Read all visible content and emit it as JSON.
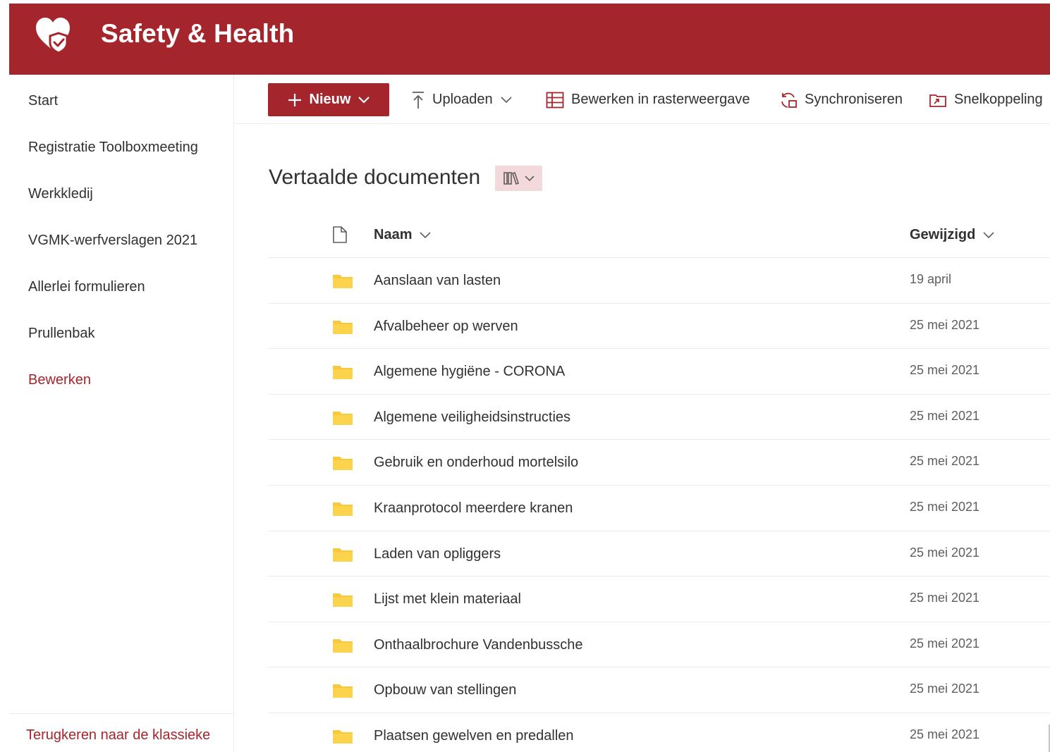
{
  "header": {
    "site_title": "Safety & Health",
    "logo_icon": "heart-shield-icon"
  },
  "colors": {
    "brand": "#a4262c",
    "view_switch_bg": "#f4d9da",
    "folder": "#f8c93c",
    "text": "#323130",
    "secondary_text": "#605e5c"
  },
  "sidebar": {
    "items": [
      {
        "label": "Start"
      },
      {
        "label": "Registratie Toolboxmeeting"
      },
      {
        "label": "Werkkledij"
      },
      {
        "label": "VGMK-werfverslagen 2021"
      },
      {
        "label": "Allerlei formulieren"
      },
      {
        "label": "Prullenbak"
      }
    ],
    "edit_label": "Bewerken",
    "back_link": "Terugkeren naar de klassieke versie van"
  },
  "commandbar": {
    "new_label": "Nieuw",
    "upload_label": "Uploaden",
    "grid_edit_label": "Bewerken in rasterweergave",
    "sync_label": "Synchroniseren",
    "shortcut_label": "Snelkoppeling"
  },
  "library": {
    "title": "Vertaalde documenten",
    "columns": {
      "name": "Naam",
      "modified": "Gewijzigd"
    },
    "rows": [
      {
        "name": "Aanslaan van lasten",
        "modified": "19 april"
      },
      {
        "name": "Afvalbeheer op werven",
        "modified": "25 mei 2021"
      },
      {
        "name": "Algemene hygiëne - CORONA",
        "modified": "25 mei 2021"
      },
      {
        "name": "Algemene veiligheidsinstructies",
        "modified": "25 mei 2021"
      },
      {
        "name": "Gebruik en onderhoud mortelsilo",
        "modified": "25 mei 2021"
      },
      {
        "name": "Kraanprotocol meerdere kranen",
        "modified": "25 mei 2021"
      },
      {
        "name": "Laden van opliggers",
        "modified": "25 mei 2021"
      },
      {
        "name": "Lijst met klein materiaal",
        "modified": "25 mei 2021"
      },
      {
        "name": "Onthaalbrochure Vandenbussche",
        "modified": "25 mei 2021"
      },
      {
        "name": "Opbouw van stellingen",
        "modified": "25 mei 2021"
      },
      {
        "name": "Plaatsen gewelven en predallen",
        "modified": "25 mei 2021"
      }
    ]
  }
}
